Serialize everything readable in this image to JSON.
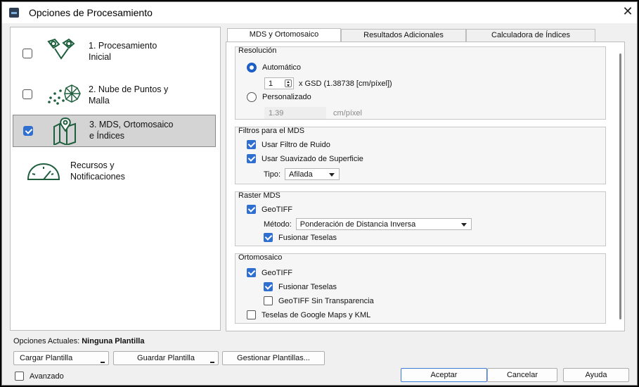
{
  "window": {
    "title": "Opciones de Procesamiento",
    "close": "✕"
  },
  "steps": [
    {
      "label": "1. Procesamiento\nInicial",
      "checked": false
    },
    {
      "label": "2. Nube de Puntos y\nMalla",
      "checked": false
    },
    {
      "label": "3. MDS, Ortomosaico\ne Índices",
      "checked": true
    },
    {
      "label": "Recursos y\nNotificaciones"
    }
  ],
  "tabs": [
    "MDS y Ortomosaico",
    "Resultados Adicionales",
    "Calculadora de Índices"
  ],
  "resolucion": {
    "title": "Resolución",
    "auto_label": "Automático",
    "spin_value": "1",
    "gsd_text": "x GSD (1.38738 [cm/píxel])",
    "custom_label": "Personalizado",
    "custom_value": "1.39",
    "custom_unit": "cm/píxel"
  },
  "filtros": {
    "title": "Filtros para el MDS",
    "ruido": "Usar Filtro de Ruido",
    "suavizado": "Usar Suavizado de Superficie",
    "tipo_label": "Tipo:",
    "tipo_value": "Afilada"
  },
  "raster": {
    "title": "Raster MDS",
    "geotiff": "GeoTIFF",
    "metodo_label": "Método:",
    "metodo_value": "Ponderación de Distancia Inversa",
    "fusionar": "Fusionar Teselas"
  },
  "orto": {
    "title": "Ortomosaico",
    "geotiff": "GeoTIFF",
    "fusionar": "Fusionar Teselas",
    "sin_transp": "GeoTIFF Sin Transparencia",
    "google": "Teselas de Google Maps y KML"
  },
  "footer": {
    "current_label": "Opciones Actuales:",
    "current_value": "Ninguna Plantilla",
    "cargar": "Cargar Plantilla",
    "guardar": "Guardar Plantilla",
    "gestionar": "Gestionar Plantillas...",
    "avanzado": "Avanzado",
    "aceptar": "Aceptar",
    "cancelar": "Cancelar",
    "ayuda": "Ayuda"
  },
  "colors": {
    "accent": "#2f6fd0",
    "selected_step": "#d4d4d4"
  }
}
